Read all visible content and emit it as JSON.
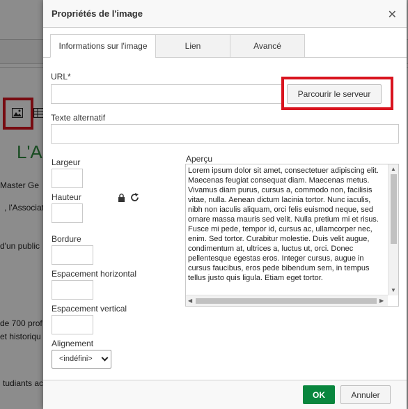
{
  "background": {
    "heading": "L'A",
    "lines": [
      "Master Ge",
      ", l'Associat",
      "d'un public",
      "de 700 prof",
      "et historiqu",
      "tudiants ac"
    ]
  },
  "dialog": {
    "title": "Propriétés de l'image",
    "close_glyph": "✕",
    "tabs": [
      {
        "label": "Informations sur l'image",
        "active": true
      },
      {
        "label": "Lien",
        "active": false
      },
      {
        "label": "Avancé",
        "active": false
      }
    ],
    "url": {
      "label": "URL*",
      "value": ""
    },
    "browse_button": "Parcourir le serveur",
    "alt_text": {
      "label": "Texte alternatif",
      "value": ""
    },
    "width": {
      "label": "Largeur",
      "value": ""
    },
    "height": {
      "label": "Hauteur",
      "value": ""
    },
    "border": {
      "label": "Bordure",
      "value": ""
    },
    "hspace": {
      "label": "Espacement horizontal",
      "value": ""
    },
    "vspace": {
      "label": "Espacement vertical",
      "value": ""
    },
    "alignment": {
      "label": "Alignement",
      "selected": "<indéfini>"
    },
    "preview": {
      "label": "Aperçu",
      "text": "Lorem ipsum dolor sit amet, consectetuer adipiscing elit. Maecenas feugiat consequat diam. Maecenas metus. Vivamus diam purus, cursus a, commodo non, facilisis vitae, nulla. Aenean dictum lacinia tortor. Nunc iaculis, nibh non iaculis aliquam, orci felis euismod neque, sed ornare massa mauris sed velit. Nulla pretium mi et risus. Fusce mi pede, tempor id, cursus ac, ullamcorper nec, enim. Sed tortor. Curabitur molestie. Duis velit augue, condimentum at, ultrices a, luctus ut, orci. Donec pellentesque egestas eros. Integer cursus, augue in cursus faucibus, eros pede bibendum sem, in tempus tellus justo quis ligula. Etiam eget tortor."
    },
    "ok_button": "OK",
    "cancel_button": "Annuler"
  },
  "colors": {
    "ok": "#09863e",
    "highlight": "#d9141f",
    "heading": "#2e8b3e"
  }
}
